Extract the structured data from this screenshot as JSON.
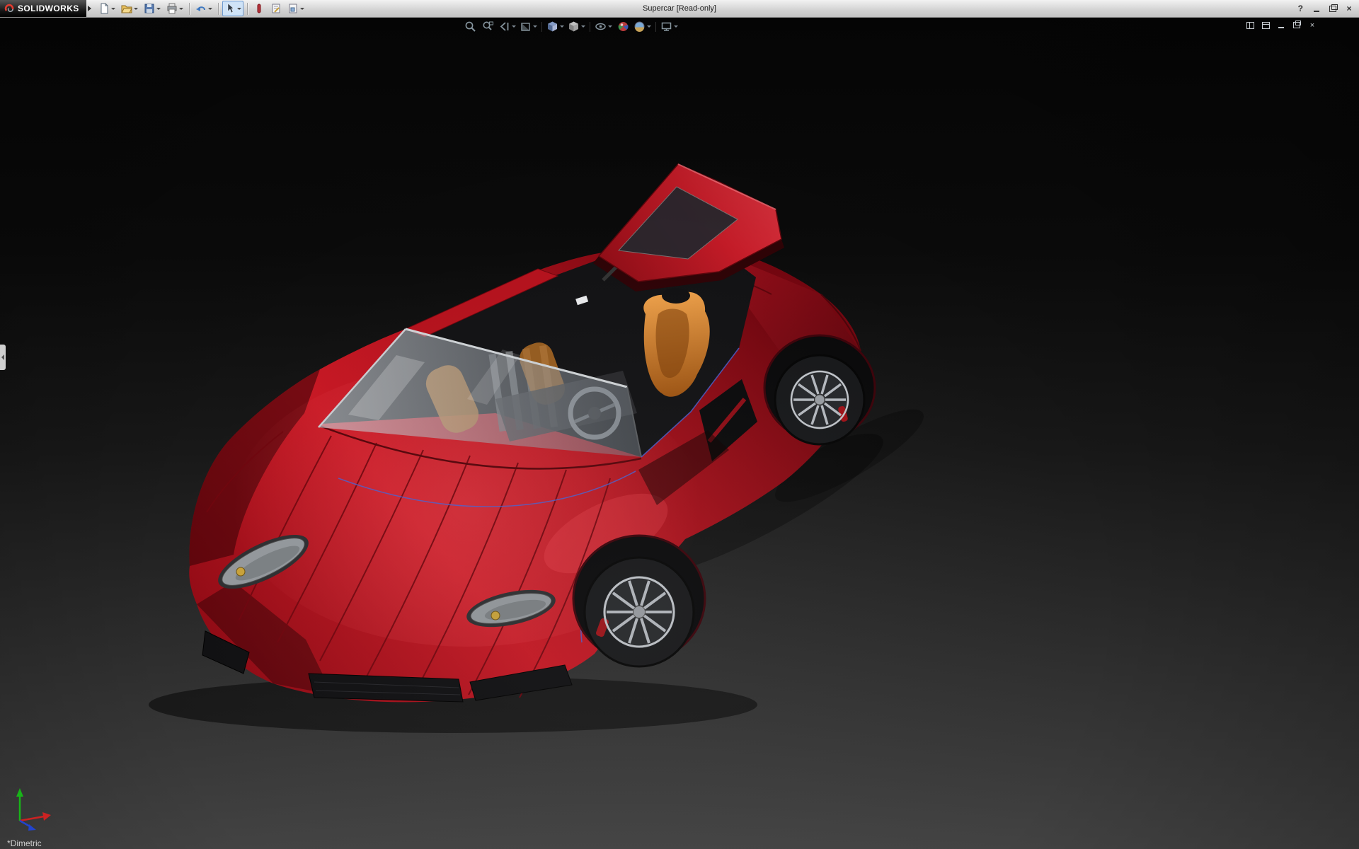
{
  "window": {
    "brand": "SOLIDWORKS",
    "title": "Supercar [Read-only]",
    "help_glyph": "?",
    "close_glyph": "×"
  },
  "main_toolbar": {
    "buttons": [
      "new-document",
      "open",
      "save",
      "print",
      "undo",
      "select",
      "xpress-products",
      "sketch-options",
      "document-properties"
    ]
  },
  "hud_toolbar": {
    "buttons": [
      "zoom-to-fit",
      "zoom-to-area",
      "previous-view",
      "section-view",
      "view-orientation",
      "display-style",
      "hide-show-items",
      "edit-appearance",
      "apply-scene",
      "view-settings"
    ]
  },
  "document_controls": {
    "buttons": [
      "cascade",
      "tile",
      "minimize",
      "restore",
      "close"
    ]
  },
  "viewport": {
    "orientation_label": "*Dimetric"
  },
  "model": {
    "name": "Supercar",
    "body_color": "#c41420",
    "interior_accent": "#d2772a",
    "glass_color": "#9aa2a9",
    "edge_highlight": "#4a63d4"
  },
  "colors": {
    "titlebar": "#d6d6d6",
    "viewport_top": "#060606",
    "viewport_bottom": "#434343",
    "triad_x": "#cc2222",
    "triad_y": "#18b418",
    "triad_z": "#2244cc"
  },
  "icons": {
    "dassault-logo-icon": "red swirl mark",
    "new-document-icon": "blank page",
    "open-icon": "folder",
    "save-icon": "floppy disk",
    "print-icon": "printer",
    "undo-icon": "curved left arrow",
    "select-icon": "cursor arrow",
    "xpress-products-icon": "red pill",
    "sketch-options-icon": "sheet with pencil",
    "document-properties-icon": "sheet with square",
    "zoom-to-fit-icon": "magnifier",
    "zoom-to-area-icon": "magnifier with rectangle",
    "previous-view-icon": "left arrow",
    "section-view-icon": "cut cube",
    "view-orientation-icon": "isometric cube",
    "display-style-icon": "shaded cube",
    "hide-show-items-icon": "eye",
    "edit-appearance-icon": "colored ball",
    "apply-scene-icon": "horizon ball",
    "view-settings-icon": "monitor"
  }
}
